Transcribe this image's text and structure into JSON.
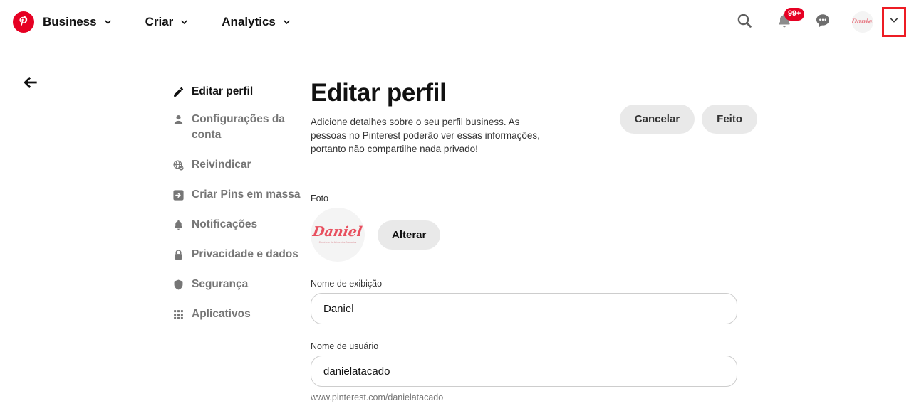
{
  "nav": {
    "logo_icon": "pinterest-logo-icon",
    "items": [
      {
        "label": "Business",
        "icon": "chevron-down-icon"
      },
      {
        "label": "Criar",
        "icon": "chevron-down-icon"
      },
      {
        "label": "Analytics",
        "icon": "chevron-down-icon"
      }
    ],
    "right": {
      "search_icon": "search-icon",
      "notifications_icon": "bell-icon",
      "notifications_badge": "99+",
      "messages_icon": "chat-bubble-icon",
      "avatar_text": "Daniel",
      "account_chevron_icon": "chevron-down-icon"
    }
  },
  "back": {
    "icon": "arrow-left-icon"
  },
  "sidebar": {
    "items": [
      {
        "label": "Editar perfil",
        "icon": "pencil-icon",
        "active": true
      },
      {
        "label": "Configurações da conta",
        "icon": "person-icon",
        "active": false
      },
      {
        "label": "Reivindicar",
        "icon": "globe-check-icon",
        "active": false
      },
      {
        "label": "Criar Pins em massa",
        "icon": "arrow-into-box-icon",
        "active": false
      },
      {
        "label": "Notificações",
        "icon": "bell-icon",
        "active": false
      },
      {
        "label": "Privacidade e dados",
        "icon": "lock-icon",
        "active": false
      },
      {
        "label": "Segurança",
        "icon": "shield-icon",
        "active": false
      },
      {
        "label": "Aplicativos",
        "icon": "grid-apps-icon",
        "active": false
      }
    ]
  },
  "main": {
    "title": "Editar perfil",
    "description": "Adicione detalhes sobre o seu perfil business. As pessoas no Pinterest poderão ver essas informações, portanto não compartilhe nada privado!",
    "cancel_label": "Cancelar",
    "done_label": "Feito",
    "photo": {
      "label": "Foto",
      "avatar_text": "Daniel",
      "avatar_subtext": "Comércio de Alimentos Atacados",
      "change_label": "Alterar"
    },
    "display_name": {
      "label": "Nome de exibição",
      "value": "Daniel",
      "placeholder": "Nome de exibição"
    },
    "username": {
      "label": "Nome de usuário",
      "value": "danielatacado",
      "placeholder": "Nome de usuário",
      "helper": "www.pinterest.com/danielatacado"
    }
  },
  "colors": {
    "brand_red": "#e60023",
    "highlight_red": "#ed1c24",
    "pill_gray": "#e9e9e9",
    "muted_text": "#767676"
  }
}
